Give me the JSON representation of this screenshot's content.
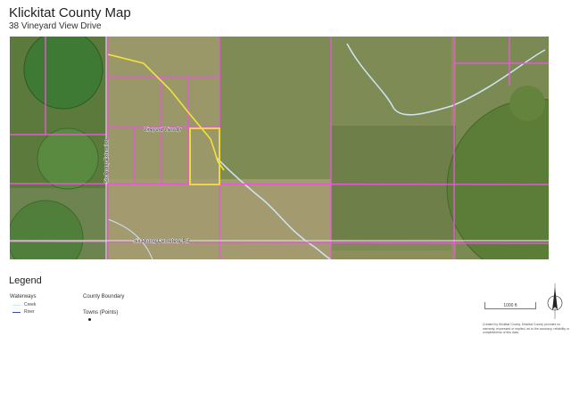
{
  "header": {
    "title": "Klickitat County Map",
    "subtitle": "38 Vineyard View Drive"
  },
  "map": {
    "roads": {
      "vineyard_view_dr": "Vineyard View Dr",
      "six_prong_extension": "Six Prong Extension",
      "six_prong_cemetery_rd": "Six Prong Cemetery Rd"
    },
    "colors": {
      "parcel_line": "#e35bd4",
      "highlight_parcel": "#f2e23a",
      "waterway": "#cfe6f2",
      "field_base": "#8c8f5a"
    }
  },
  "legend": {
    "title": "Legend",
    "waterways": {
      "heading": "Waterways",
      "creek": "Creek",
      "river": "River"
    },
    "county_boundary": "County Boundary",
    "towns": "Towns (Points)"
  },
  "scale": {
    "label": "1000 ft"
  },
  "disclaimer": "Created by Klickitat County. Klickitat County provides no warranty, expressed or implied, as to the accuracy, reliability or completeness of this data."
}
